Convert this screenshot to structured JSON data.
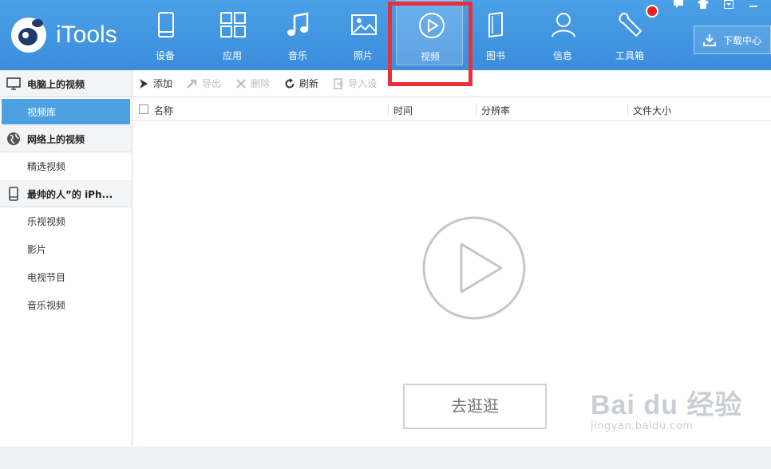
{
  "app": {
    "name": "iTools"
  },
  "nav": {
    "items": [
      {
        "label": "设备",
        "icon": "device-icon"
      },
      {
        "label": "应用",
        "icon": "apps-icon"
      },
      {
        "label": "音乐",
        "icon": "music-icon"
      },
      {
        "label": "照片",
        "icon": "photo-icon"
      },
      {
        "label": "视频",
        "icon": "video-play-icon",
        "active": true
      },
      {
        "label": "图书",
        "icon": "book-icon"
      },
      {
        "label": "信息",
        "icon": "user-icon"
      },
      {
        "label": "工具箱",
        "icon": "wrench-icon"
      }
    ],
    "download_center": "下载中心"
  },
  "sidebar": {
    "groups": [
      {
        "title": "电脑上的视频",
        "icon": "monitor-icon",
        "items": [
          "视频库"
        ]
      },
      {
        "title": "网络上的视频",
        "icon": "globe-icon",
        "items": [
          "精选视频"
        ]
      },
      {
        "title": "最帅的人”的 iPh...",
        "icon": "phone-icon",
        "items": [
          "乐视视频",
          "影片",
          "电视节目",
          "音乐视频"
        ]
      }
    ],
    "active_item": "视频库"
  },
  "toolbar": {
    "add": "添加",
    "export": "导出",
    "delete": "删除",
    "refresh": "刷新",
    "import": "导入设"
  },
  "table": {
    "columns": [
      "名称",
      "时间",
      "分辨率",
      "文件大小"
    ]
  },
  "empty_state": {
    "button": "去逛逛"
  },
  "watermark": {
    "main": "Bai du 经验",
    "sub": "jingyan.baidu.com"
  },
  "colors": {
    "header": "#3b8ddc",
    "active_sidebar": "#4da1e0",
    "highlight_box": "#e8303a"
  }
}
